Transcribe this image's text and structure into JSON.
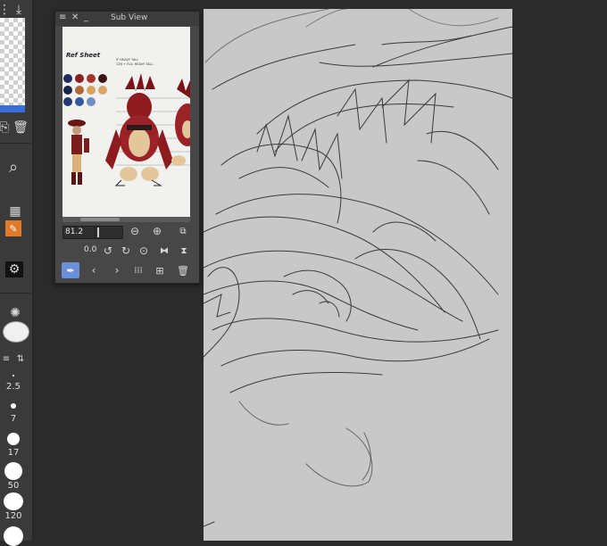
{
  "subview": {
    "title": "Sub View",
    "zoom_value": "81.2",
    "rotation_value": "0.0",
    "reference_text": {
      "heading": "Ref Sheet",
      "height_tag_1": "9' HEAVY TALL",
      "height_tag_2": "12ft + FLS: HEAVY TALL"
    },
    "palette": [
      "#1c2a5e",
      "#8b1e1e",
      "#a8322c",
      "#3a1616",
      "#1a2547",
      "#b0673a",
      "#d4a35e",
      "#1e3a75",
      "#2f5aa0",
      "#6f8fc4",
      "#d8a56a"
    ]
  },
  "brushes": {
    "sizes": [
      "2.5",
      "7",
      "17",
      "50",
      "120"
    ]
  },
  "colors": {
    "accent_blue": "#3b6fd8",
    "eyedropper_active": "#6b8fd9",
    "canvas": "#c8c8c8",
    "app_bg": "#2b2b2b",
    "brush_orange": "#e07b2c"
  }
}
